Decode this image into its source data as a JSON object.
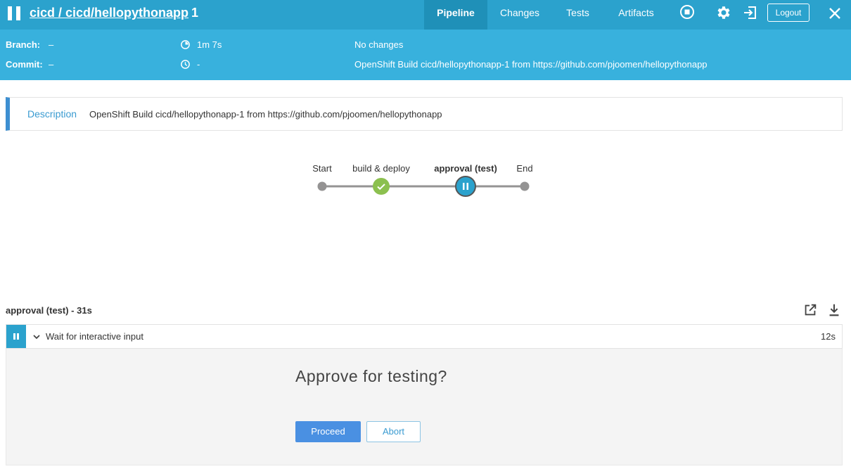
{
  "header": {
    "title_link": "cicd / cicd/hellopythonapp",
    "run_number": "1",
    "tabs": [
      {
        "label": "Pipeline",
        "active": true
      },
      {
        "label": "Changes",
        "active": false
      },
      {
        "label": "Tests",
        "active": false
      },
      {
        "label": "Artifacts",
        "active": false
      }
    ],
    "icons": [
      "stop-icon",
      "gear-icon",
      "exit-icon",
      "close-icon"
    ],
    "logout_label": "Logout"
  },
  "run_info": {
    "branch_label": "Branch:",
    "branch_value": "–",
    "commit_label": "Commit:",
    "commit_value": "–",
    "duration": "1m 7s",
    "started": "-",
    "changes": "No changes",
    "cause": "OpenShift Build cicd/hellopythonapp-1 from https://github.com/pjoomen/hellopythonapp"
  },
  "description": {
    "label": "Description",
    "text": "OpenShift Build cicd/hellopythonapp-1 from https://github.com/pjoomen/hellopythonapp"
  },
  "pipeline": {
    "nodes": [
      {
        "label": "Start",
        "status": "start"
      },
      {
        "label": "build & deploy",
        "status": "success"
      },
      {
        "label": "approval (test)",
        "status": "paused"
      },
      {
        "label": "End",
        "status": "end"
      }
    ]
  },
  "step": {
    "title": "approval (test) - 31s",
    "log_text": "Wait for interactive input",
    "log_time": "12s"
  },
  "input": {
    "question": "Approve for testing?",
    "proceed_label": "Proceed",
    "abort_label": "Abort"
  },
  "colors": {
    "header": "#2ba2cd",
    "subheader": "#38b1dd",
    "success": "#8cc04f",
    "paused": "#2ba2cd",
    "primary_button": "#4a90e2"
  }
}
